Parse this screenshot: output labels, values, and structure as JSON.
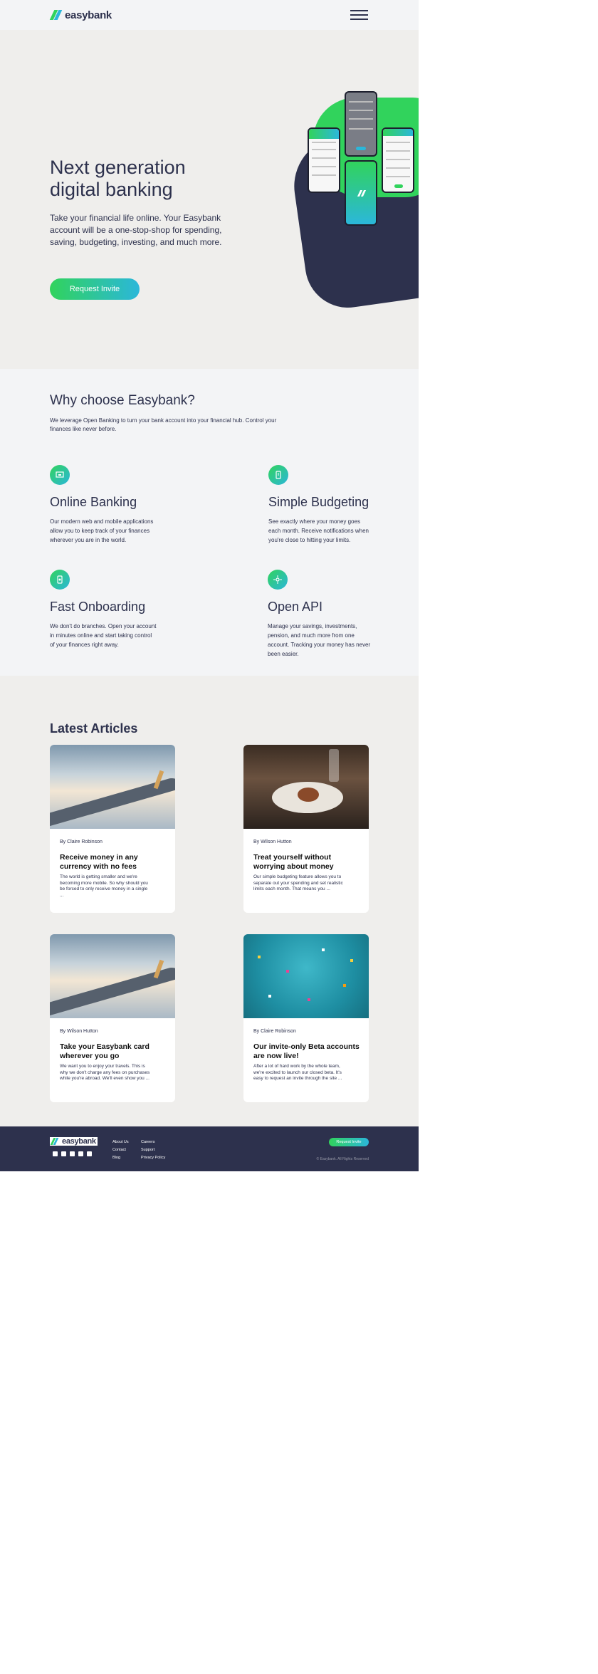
{
  "header": {
    "logo_text": "easybank",
    "menu_icon": "hamburger-icon"
  },
  "hero": {
    "title": "Next generation digital banking",
    "text": "Take your financial life online. Your Easybank account will be a one-stop-shop for spending, saving, budgeting, investing, and much more.",
    "button_label": "Request Invite"
  },
  "why": {
    "title": "Why choose Easybank?",
    "subtitle": "We leverage Open Banking to turn your bank account into your financial hub. Control your finances like never before.",
    "features": [
      {
        "icon": "online-banking-icon",
        "title": "Online Banking",
        "text": "Our modern web and mobile applications allow you to keep track of your finances wherever you are in the world."
      },
      {
        "icon": "budgeting-icon",
        "title": "Simple Budgeting",
        "text": "See exactly where your money goes each month. Receive notifications when you're close to hitting your limits."
      },
      {
        "icon": "onboarding-icon",
        "title": "Fast Onboarding",
        "text": "We don't do branches. Open your account in minutes online and start taking control of your finances right away."
      },
      {
        "icon": "api-icon",
        "title": "Open API",
        "text": "Manage your savings, investments, pension, and much more from one account. Tracking your money has never been easier."
      }
    ]
  },
  "articles": {
    "title": "Latest Articles",
    "items": [
      {
        "image": "airplane-wing-clouds",
        "author": "By Claire Robinson",
        "title": "Receive money in any currency with no fees",
        "text": "The world is getting smaller and we're becoming more mobile. So why should you be forced to only receive money in a single ..."
      },
      {
        "image": "restaurant-dinner",
        "author": "By Wilson Hutton",
        "title": "Treat yourself without worrying about money",
        "text": "Our simple budgeting feature allows you to separate out your spending and set realistic limits each month. That means you ..."
      },
      {
        "image": "airplane-wing-clouds",
        "author": "By Wilson Hutton",
        "title": "Take your Easybank card wherever you go",
        "text": "We want you to enjoy your travels. This is why we don't charge any fees on purchases while you're abroad. We'll even show you ..."
      },
      {
        "image": "confetti-teal",
        "author": "By Claire Robinson",
        "title": "Our invite-only Beta accounts are now live!",
        "text": "After a lot of hard work by the whole team, we're excited to launch our closed beta. It's easy to request an invite through the site ..."
      }
    ]
  },
  "footer": {
    "logo_text": "easybank",
    "social_icons": [
      "facebook-icon",
      "youtube-icon",
      "twitter-icon",
      "pinterest-icon",
      "instagram-icon"
    ],
    "links_col1": [
      "About Us",
      "Contact",
      "Blog"
    ],
    "links_col2": [
      "Careers",
      "Support",
      "Privacy Policy"
    ],
    "button_label": "Request Invite",
    "copyright": "© Easybank. All Rights Reserved"
  },
  "colors": {
    "dark_blue": "#2d314d",
    "lime_green": "#31d35c",
    "bright_cyan": "#2bb7da",
    "light_gray": "#f3f4f6"
  }
}
